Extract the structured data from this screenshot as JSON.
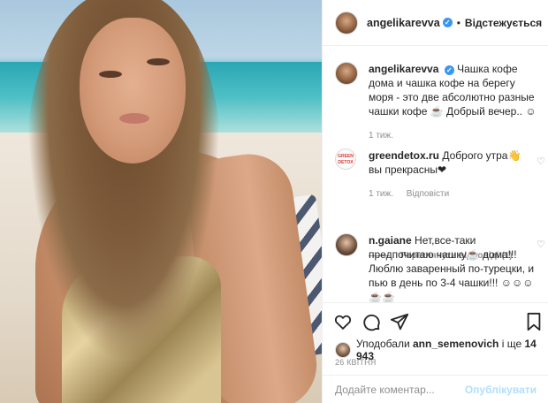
{
  "post": {
    "username": "angelikarevva",
    "follow_label": "Відстежується",
    "verified_mark": "✓"
  },
  "caption": {
    "username": "angelikarevva",
    "text": "Чашка кофе дома и чашка кофе на берегу моря - это две абсолютно разные чашки кофе ☕ Добрый вечер.. ☺",
    "time": "1 тиж."
  },
  "comments": [
    {
      "username": "greendetox.ru",
      "text": "Доброго утра👋 вы прекрасны❤",
      "time": "1 тиж.",
      "reply_label": "Відповісти",
      "avatar_label": "GREEN DETOX"
    },
    {
      "username": "n.gaiane",
      "text": "Нет,все-таки предпочитаю чашку☕ дома!!! Люблю заваренный по-турецки, и пью в день по 3-4 чашки!!! ☺☺☺☕☕"
    }
  ],
  "view_replies_label": "Переглянути відповіді (1)",
  "likes": {
    "prefix": "Уподобали",
    "user": "ann_semenovich",
    "suffix": "і ще",
    "count": "14 943"
  },
  "date": "26 КВІТНЯ",
  "add_comment": {
    "placeholder": "Додайте коментар...",
    "publish_label": "Опублікувати"
  }
}
